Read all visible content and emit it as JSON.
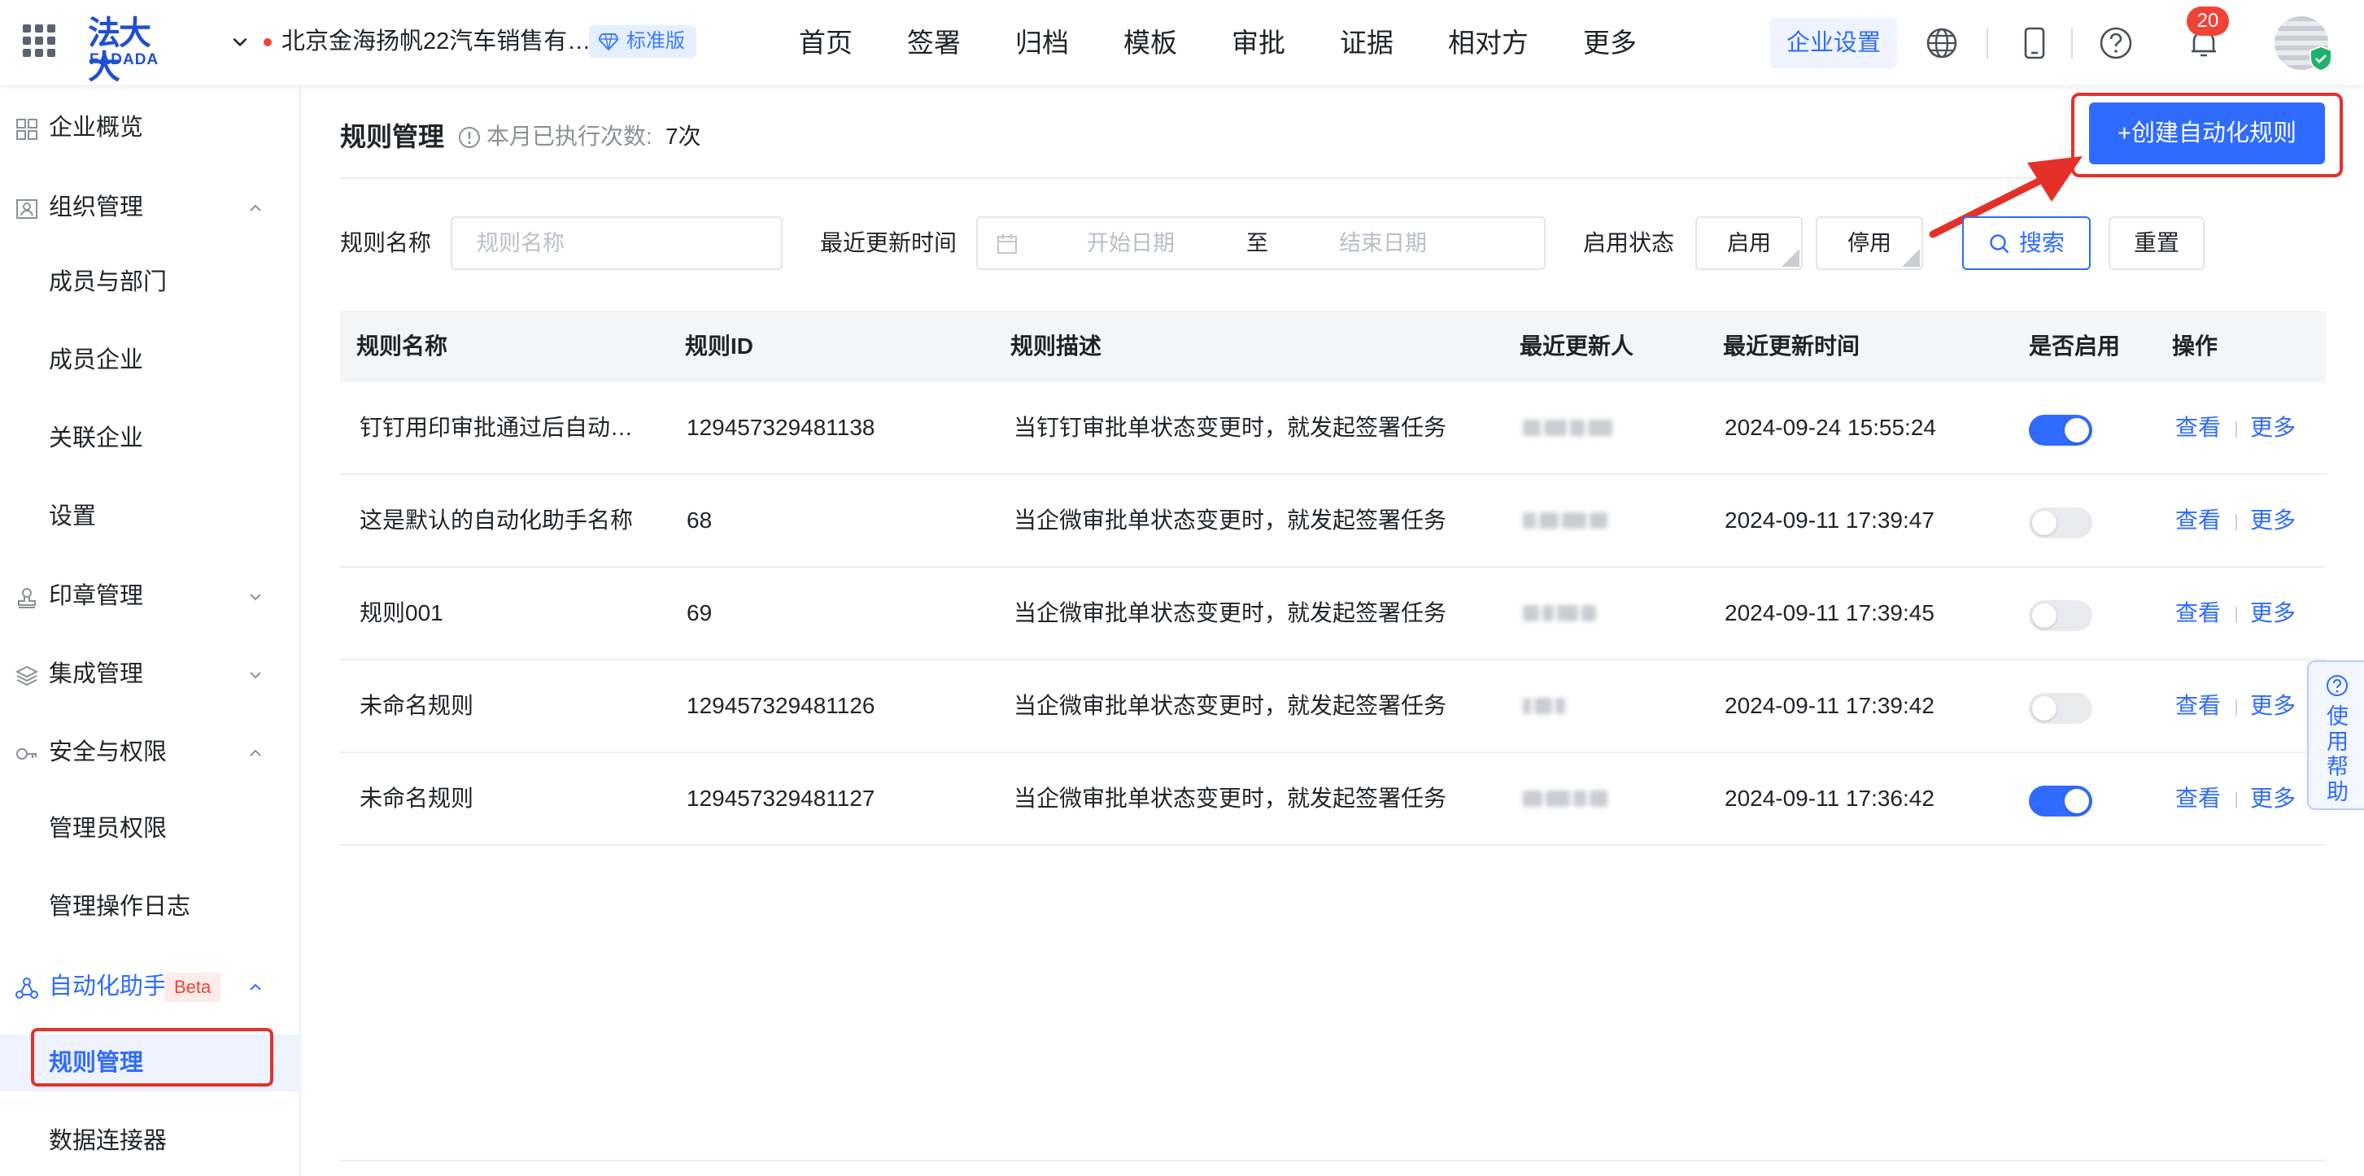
{
  "header": {
    "logo_cn": "法大大",
    "logo_en": "FADADA",
    "company_name": "北京金海扬帆22汽车销售有…",
    "edition": "标准版",
    "nav": [
      "首页",
      "签署",
      "归档",
      "模板",
      "审批",
      "证据",
      "相对方",
      "更多"
    ],
    "enterprise_settings": "企业设置",
    "notification_count": "20"
  },
  "sidebar": {
    "items": [
      {
        "label": "企业概览"
      },
      {
        "label": "组织管理"
      },
      {
        "label": "成员与部门"
      },
      {
        "label": "成员企业"
      },
      {
        "label": "关联企业"
      },
      {
        "label": "设置"
      },
      {
        "label": "印章管理"
      },
      {
        "label": "集成管理"
      },
      {
        "label": "安全与权限"
      },
      {
        "label": "管理员权限"
      },
      {
        "label": "管理操作日志"
      },
      {
        "label": "自动化助手",
        "tag": "Beta"
      },
      {
        "label": "规则管理"
      },
      {
        "label": "数据连接器"
      }
    ]
  },
  "page": {
    "title": "规则管理",
    "exec_label": "本月已执行次数:",
    "exec_value": "7次",
    "create_button": "+创建自动化规则"
  },
  "filters": {
    "name_label": "规则名称",
    "name_placeholder": "规则名称",
    "time_label": "最近更新时间",
    "start_placeholder": "开始日期",
    "to": "至",
    "end_placeholder": "结束日期",
    "status_label": "启用状态",
    "enable": "启用",
    "disable": "停用",
    "search": "搜索",
    "reset": "重置"
  },
  "table": {
    "headers": [
      "规则名称",
      "规则ID",
      "规则描述",
      "最近更新人",
      "最近更新时间",
      "是否启用",
      "操作"
    ],
    "rows": [
      {
        "name": "钉钉用印审批通过后自动…",
        "id": "129457329481138",
        "desc": "当钉钉审批单状态变更时，就发起签署任务",
        "time": "2024-09-24 15:55:24",
        "enabled": true
      },
      {
        "name": "这是默认的自动化助手名称",
        "id": "68",
        "desc": "当企微审批单状态变更时，就发起签署任务",
        "time": "2024-09-11 17:39:47",
        "enabled": false
      },
      {
        "name": "规则001",
        "id": "69",
        "desc": "当企微审批单状态变更时，就发起签署任务",
        "time": "2024-09-11 17:39:45",
        "enabled": false
      },
      {
        "name": "未命名规则",
        "id": "129457329481126",
        "desc": "当企微审批单状态变更时，就发起签署任务",
        "time": "2024-09-11 17:39:42",
        "enabled": false
      },
      {
        "name": "未命名规则",
        "id": "129457329481127",
        "desc": "当企微审批单状态变更时，就发起签署任务",
        "time": "2024-09-11 17:36:42",
        "enabled": true
      }
    ],
    "view": "查看",
    "more": "更多"
  },
  "help": {
    "label": "使用帮助"
  },
  "colors": {
    "primary": "#2f6bff",
    "highlight": "#e5302a",
    "alert": "#f04336"
  }
}
